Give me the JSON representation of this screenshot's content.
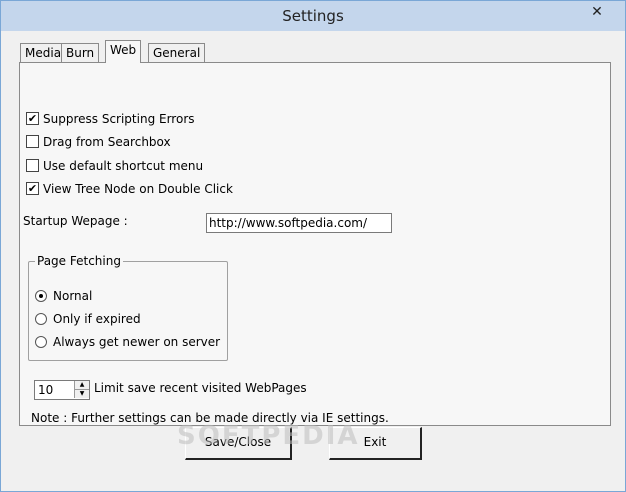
{
  "window": {
    "title": "Settings",
    "close_glyph": "✕"
  },
  "tabs": [
    {
      "label": "Media"
    },
    {
      "label": "Burn"
    },
    {
      "label": "Web"
    },
    {
      "label": "General"
    }
  ],
  "active_tab": "Web",
  "checkboxes": [
    {
      "label": "Suppress Scripting Errors",
      "checked": true
    },
    {
      "label": "Drag from Searchbox",
      "checked": false
    },
    {
      "label": "Use default shortcut menu",
      "checked": false
    },
    {
      "label": "View Tree Node on Double Click",
      "checked": true
    }
  ],
  "startup": {
    "label": "Startup Wepage :",
    "value": "http://www.softpedia.com/"
  },
  "page_fetching": {
    "title": "Page Fetching",
    "options": [
      {
        "label": "Nornal",
        "selected": true
      },
      {
        "label": "Only if expired",
        "selected": false
      },
      {
        "label": "Always get newer on server",
        "selected": false
      }
    ]
  },
  "limit": {
    "value": "10",
    "label": "Limit save recent visited WebPages"
  },
  "note": "Note : Further settings can be made directly via IE settings.",
  "buttons": {
    "save_close": "Save/Close",
    "exit": "Exit"
  },
  "watermark": "SOFTPEDIA",
  "glyphs": {
    "check": "✔",
    "up": "▲",
    "down": "▼"
  }
}
